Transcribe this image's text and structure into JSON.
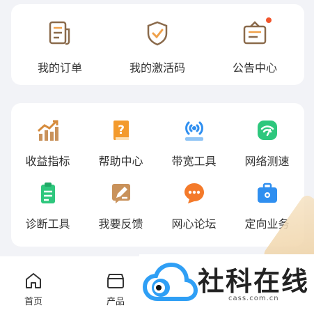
{
  "top_card": {
    "items": [
      {
        "label": "我的订单",
        "icon": "receipt-icon"
      },
      {
        "label": "我的激活码",
        "icon": "shield-check-icon"
      },
      {
        "label": "公告中心",
        "icon": "notice-board-icon"
      }
    ]
  },
  "services": {
    "items": [
      {
        "label": "收益指标",
        "icon": "growth-chart-icon"
      },
      {
        "label": "帮助中心",
        "icon": "help-book-icon"
      },
      {
        "label": "带宽工具",
        "icon": "broadcast-tower-icon"
      },
      {
        "label": "网络测速",
        "icon": "wifi-speed-icon"
      },
      {
        "label": "诊断工具",
        "icon": "clipboard-icon"
      },
      {
        "label": "我要反馈",
        "icon": "feedback-edit-icon"
      },
      {
        "label": "网心论坛",
        "icon": "chat-bubble-icon"
      },
      {
        "label": "定向业务",
        "icon": "briefcase-icon"
      }
    ]
  },
  "tabbar": {
    "tabs": [
      {
        "label": "首页",
        "icon": "home-icon"
      },
      {
        "label": "产品",
        "icon": "box-icon"
      }
    ]
  },
  "watermark": {
    "text": "社科在线",
    "url": "cass.com.cn"
  },
  "colors": {
    "brown": "#8a6a4b",
    "orange": "#f39a2c",
    "blue": "#2f8ff0",
    "green": "#2ec77d",
    "notice_dot": "#f2552c"
  }
}
